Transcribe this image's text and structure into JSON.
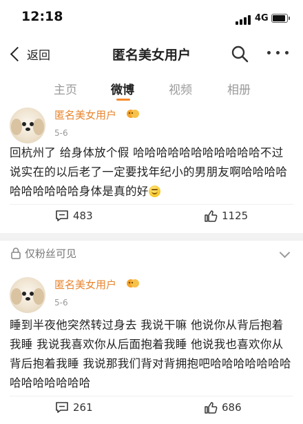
{
  "status_bar": {
    "time": "12:18",
    "network": "4G",
    "battery_level": 0.8
  },
  "nav": {
    "back_label": "返回",
    "title": "匿名美女用户"
  },
  "tabs": [
    {
      "label": "主页",
      "active": false
    },
    {
      "label": "微博",
      "active": true
    },
    {
      "label": "视频",
      "active": false
    },
    {
      "label": "相册",
      "active": false
    }
  ],
  "posts": [
    {
      "username": "匿名美女用户",
      "date": "5-6",
      "text": "回杭州了 给身体放个假 哈哈哈哈哈哈哈哈哈哈哈不过说实在的以后老了一定要找年纪小的男朋友啊哈哈哈哈哈哈哈哈哈哈身体是真的好",
      "emoji": "smile-icon",
      "comments": "483",
      "likes": "1125"
    },
    {
      "visibility": "仅粉丝可见",
      "username": "匿名美女用户",
      "date": "5-6",
      "text": "睡到半夜他突然转过身去 我说干嘛 他说你从背后抱着我睡 我说我喜欢你从后面抱着我睡 他说我也喜欢你从背后抱着我睡 我说那我们背对背拥抱吧哈哈哈哈哈哈哈哈哈哈哈哈哈哈",
      "comments": "261",
      "likes": "686"
    }
  ],
  "colors": {
    "accent": "#f78a2a",
    "username": "#e8852e"
  }
}
